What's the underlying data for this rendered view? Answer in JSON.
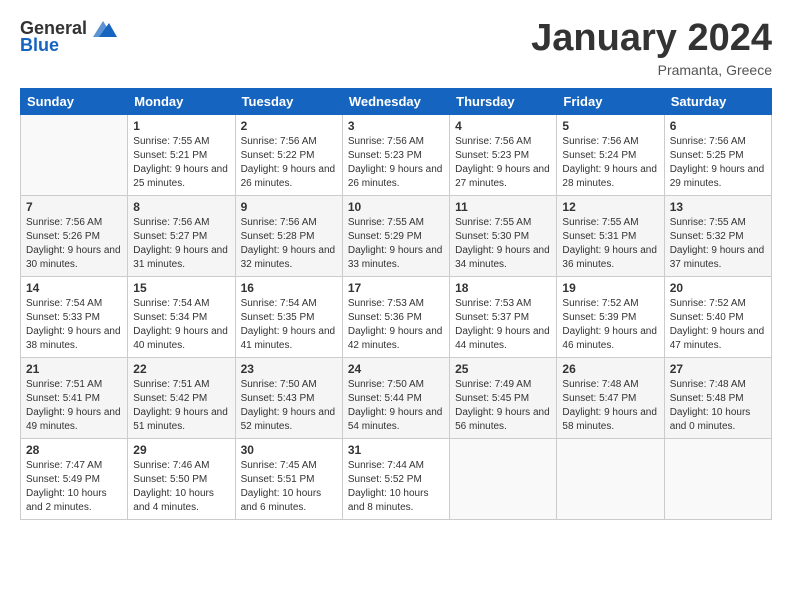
{
  "logo": {
    "general": "General",
    "blue": "Blue"
  },
  "title": "January 2024",
  "subtitle": "Pramanta, Greece",
  "days_of_week": [
    "Sunday",
    "Monday",
    "Tuesday",
    "Wednesday",
    "Thursday",
    "Friday",
    "Saturday"
  ],
  "weeks": [
    [
      {
        "num": "",
        "sunrise": "",
        "sunset": "",
        "daylight": ""
      },
      {
        "num": "1",
        "sunrise": "Sunrise: 7:55 AM",
        "sunset": "Sunset: 5:21 PM",
        "daylight": "Daylight: 9 hours and 25 minutes."
      },
      {
        "num": "2",
        "sunrise": "Sunrise: 7:56 AM",
        "sunset": "Sunset: 5:22 PM",
        "daylight": "Daylight: 9 hours and 26 minutes."
      },
      {
        "num": "3",
        "sunrise": "Sunrise: 7:56 AM",
        "sunset": "Sunset: 5:23 PM",
        "daylight": "Daylight: 9 hours and 26 minutes."
      },
      {
        "num": "4",
        "sunrise": "Sunrise: 7:56 AM",
        "sunset": "Sunset: 5:23 PM",
        "daylight": "Daylight: 9 hours and 27 minutes."
      },
      {
        "num": "5",
        "sunrise": "Sunrise: 7:56 AM",
        "sunset": "Sunset: 5:24 PM",
        "daylight": "Daylight: 9 hours and 28 minutes."
      },
      {
        "num": "6",
        "sunrise": "Sunrise: 7:56 AM",
        "sunset": "Sunset: 5:25 PM",
        "daylight": "Daylight: 9 hours and 29 minutes."
      }
    ],
    [
      {
        "num": "7",
        "sunrise": "Sunrise: 7:56 AM",
        "sunset": "Sunset: 5:26 PM",
        "daylight": "Daylight: 9 hours and 30 minutes."
      },
      {
        "num": "8",
        "sunrise": "Sunrise: 7:56 AM",
        "sunset": "Sunset: 5:27 PM",
        "daylight": "Daylight: 9 hours and 31 minutes."
      },
      {
        "num": "9",
        "sunrise": "Sunrise: 7:56 AM",
        "sunset": "Sunset: 5:28 PM",
        "daylight": "Daylight: 9 hours and 32 minutes."
      },
      {
        "num": "10",
        "sunrise": "Sunrise: 7:55 AM",
        "sunset": "Sunset: 5:29 PM",
        "daylight": "Daylight: 9 hours and 33 minutes."
      },
      {
        "num": "11",
        "sunrise": "Sunrise: 7:55 AM",
        "sunset": "Sunset: 5:30 PM",
        "daylight": "Daylight: 9 hours and 34 minutes."
      },
      {
        "num": "12",
        "sunrise": "Sunrise: 7:55 AM",
        "sunset": "Sunset: 5:31 PM",
        "daylight": "Daylight: 9 hours and 36 minutes."
      },
      {
        "num": "13",
        "sunrise": "Sunrise: 7:55 AM",
        "sunset": "Sunset: 5:32 PM",
        "daylight": "Daylight: 9 hours and 37 minutes."
      }
    ],
    [
      {
        "num": "14",
        "sunrise": "Sunrise: 7:54 AM",
        "sunset": "Sunset: 5:33 PM",
        "daylight": "Daylight: 9 hours and 38 minutes."
      },
      {
        "num": "15",
        "sunrise": "Sunrise: 7:54 AM",
        "sunset": "Sunset: 5:34 PM",
        "daylight": "Daylight: 9 hours and 40 minutes."
      },
      {
        "num": "16",
        "sunrise": "Sunrise: 7:54 AM",
        "sunset": "Sunset: 5:35 PM",
        "daylight": "Daylight: 9 hours and 41 minutes."
      },
      {
        "num": "17",
        "sunrise": "Sunrise: 7:53 AM",
        "sunset": "Sunset: 5:36 PM",
        "daylight": "Daylight: 9 hours and 42 minutes."
      },
      {
        "num": "18",
        "sunrise": "Sunrise: 7:53 AM",
        "sunset": "Sunset: 5:37 PM",
        "daylight": "Daylight: 9 hours and 44 minutes."
      },
      {
        "num": "19",
        "sunrise": "Sunrise: 7:52 AM",
        "sunset": "Sunset: 5:39 PM",
        "daylight": "Daylight: 9 hours and 46 minutes."
      },
      {
        "num": "20",
        "sunrise": "Sunrise: 7:52 AM",
        "sunset": "Sunset: 5:40 PM",
        "daylight": "Daylight: 9 hours and 47 minutes."
      }
    ],
    [
      {
        "num": "21",
        "sunrise": "Sunrise: 7:51 AM",
        "sunset": "Sunset: 5:41 PM",
        "daylight": "Daylight: 9 hours and 49 minutes."
      },
      {
        "num": "22",
        "sunrise": "Sunrise: 7:51 AM",
        "sunset": "Sunset: 5:42 PM",
        "daylight": "Daylight: 9 hours and 51 minutes."
      },
      {
        "num": "23",
        "sunrise": "Sunrise: 7:50 AM",
        "sunset": "Sunset: 5:43 PM",
        "daylight": "Daylight: 9 hours and 52 minutes."
      },
      {
        "num": "24",
        "sunrise": "Sunrise: 7:50 AM",
        "sunset": "Sunset: 5:44 PM",
        "daylight": "Daylight: 9 hours and 54 minutes."
      },
      {
        "num": "25",
        "sunrise": "Sunrise: 7:49 AM",
        "sunset": "Sunset: 5:45 PM",
        "daylight": "Daylight: 9 hours and 56 minutes."
      },
      {
        "num": "26",
        "sunrise": "Sunrise: 7:48 AM",
        "sunset": "Sunset: 5:47 PM",
        "daylight": "Daylight: 9 hours and 58 minutes."
      },
      {
        "num": "27",
        "sunrise": "Sunrise: 7:48 AM",
        "sunset": "Sunset: 5:48 PM",
        "daylight": "Daylight: 10 hours and 0 minutes."
      }
    ],
    [
      {
        "num": "28",
        "sunrise": "Sunrise: 7:47 AM",
        "sunset": "Sunset: 5:49 PM",
        "daylight": "Daylight: 10 hours and 2 minutes."
      },
      {
        "num": "29",
        "sunrise": "Sunrise: 7:46 AM",
        "sunset": "Sunset: 5:50 PM",
        "daylight": "Daylight: 10 hours and 4 minutes."
      },
      {
        "num": "30",
        "sunrise": "Sunrise: 7:45 AM",
        "sunset": "Sunset: 5:51 PM",
        "daylight": "Daylight: 10 hours and 6 minutes."
      },
      {
        "num": "31",
        "sunrise": "Sunrise: 7:44 AM",
        "sunset": "Sunset: 5:52 PM",
        "daylight": "Daylight: 10 hours and 8 minutes."
      },
      {
        "num": "",
        "sunrise": "",
        "sunset": "",
        "daylight": ""
      },
      {
        "num": "",
        "sunrise": "",
        "sunset": "",
        "daylight": ""
      },
      {
        "num": "",
        "sunrise": "",
        "sunset": "",
        "daylight": ""
      }
    ]
  ]
}
